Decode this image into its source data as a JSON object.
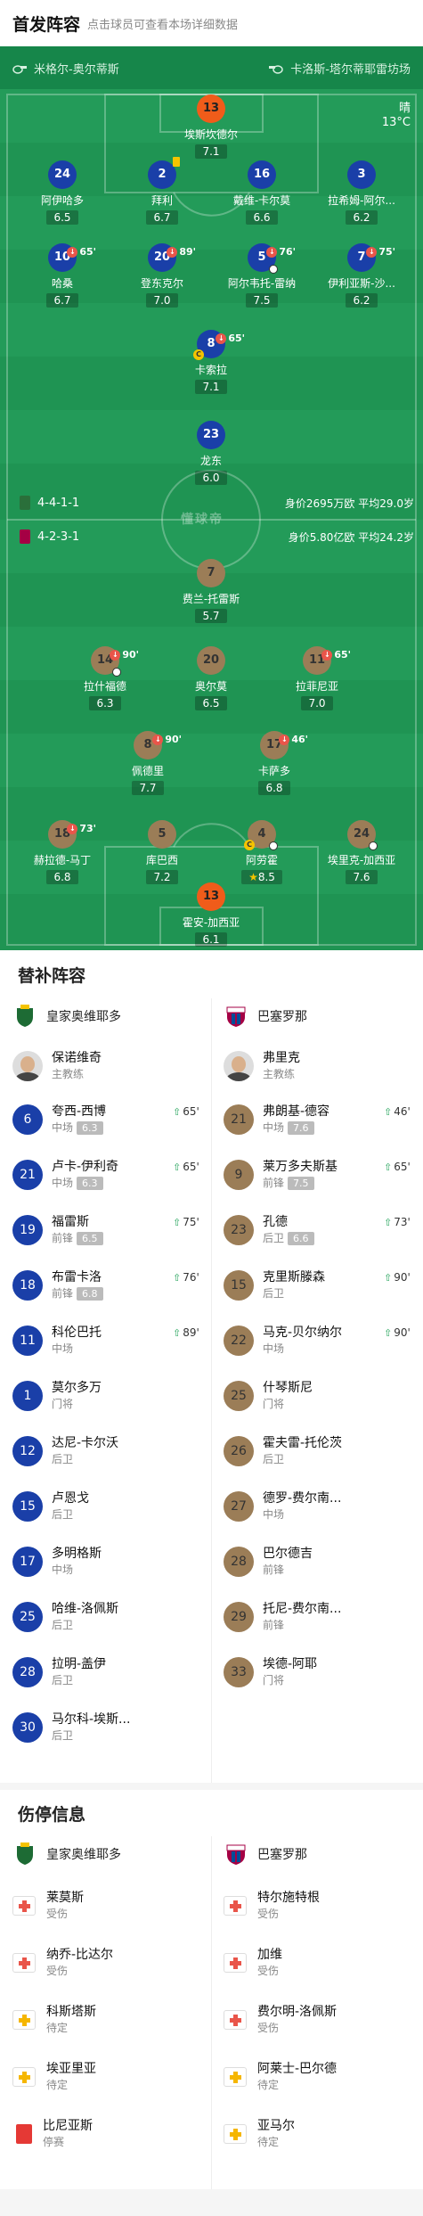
{
  "header": {
    "title": "首发阵容",
    "subtitle": "点击球员可查看本场详细数据"
  },
  "teams": {
    "home": "米格尔-奥尔蒂斯",
    "away": "卡洛斯-塔尔蒂耶雷坊场"
  },
  "weather": {
    "condition": "晴",
    "temp": "13°C"
  },
  "watermark": "懂球帝",
  "home_formation": {
    "formation": "4-4-1-1",
    "value": "身价2695万欧",
    "age": "平均29.0岁"
  },
  "away_formation": {
    "formation": "4-2-3-1",
    "value": "身价5.80亿欧",
    "age": "平均24.2岁"
  },
  "home_players": [
    {
      "no": "13",
      "name": "埃斯坎德尔",
      "rating": "7.1"
    },
    {
      "no": "24",
      "name": "阿伊哈多",
      "rating": "6.5"
    },
    {
      "no": "2",
      "name": "拜利",
      "rating": "6.7"
    },
    {
      "no": "16",
      "name": "戴维-卡尔莫",
      "rating": "6.6"
    },
    {
      "no": "3",
      "name": "拉希姆-阿尔...",
      "rating": "6.2"
    },
    {
      "no": "10",
      "name": "哈桑",
      "rating": "6.7",
      "sub": "65'"
    },
    {
      "no": "20",
      "name": "登东克尔",
      "rating": "7.0",
      "sub": "89'"
    },
    {
      "no": "5",
      "name": "阿尔韦托-雷纳",
      "rating": "7.5",
      "sub": "76'"
    },
    {
      "no": "7",
      "name": "伊利亚斯-沙...",
      "rating": "6.2",
      "sub": "75'"
    },
    {
      "no": "8",
      "name": "卡索拉",
      "rating": "7.1",
      "sub": "65'"
    },
    {
      "no": "23",
      "name": "龙东",
      "rating": "6.0"
    }
  ],
  "away_players": [
    {
      "no": "7",
      "name": "费兰-托雷斯",
      "rating": "5.7"
    },
    {
      "no": "14",
      "name": "拉什福德",
      "rating": "6.3",
      "sub": "90'"
    },
    {
      "no": "20",
      "name": "奥尔莫",
      "rating": "6.5"
    },
    {
      "no": "11",
      "name": "拉菲尼亚",
      "rating": "7.0",
      "sub": "65'"
    },
    {
      "no": "8",
      "name": "佩德里",
      "rating": "7.7",
      "sub": "90'"
    },
    {
      "no": "17",
      "name": "卡萨多",
      "rating": "6.8",
      "sub": "46'"
    },
    {
      "no": "18",
      "name": "赫拉德-马丁",
      "rating": "6.8",
      "sub": "73'"
    },
    {
      "no": "5",
      "name": "库巴西",
      "rating": "7.2"
    },
    {
      "no": "4",
      "name": "阿劳霍",
      "rating": "8.5"
    },
    {
      "no": "24",
      "name": "埃里克-加西亚",
      "rating": "7.6"
    },
    {
      "no": "13",
      "name": "霍安-加西亚",
      "rating": "6.1"
    }
  ],
  "subs": {
    "title": "替补阵容",
    "home_team": "皇家奥维耶多",
    "away_team": "巴塞罗那",
    "home_coach": {
      "name": "保诺维奇",
      "role": "主教练"
    },
    "away_coach": {
      "name": "弗里克",
      "role": "主教练"
    },
    "home": [
      {
        "no": "6",
        "name": "夸西-西博",
        "pos": "中场",
        "rating": "6.3",
        "min": "65'"
      },
      {
        "no": "21",
        "name": "卢卡-伊利奇",
        "pos": "中场",
        "rating": "6.3",
        "min": "65'"
      },
      {
        "no": "19",
        "name": "福雷斯",
        "pos": "前锋",
        "rating": "6.5",
        "min": "75'"
      },
      {
        "no": "18",
        "name": "布雷卡洛",
        "pos": "前锋",
        "rating": "6.8",
        "min": "76'"
      },
      {
        "no": "11",
        "name": "科伦巴托",
        "pos": "中场",
        "rating": "",
        "min": "89'"
      },
      {
        "no": "1",
        "name": "莫尔多万",
        "pos": "门将",
        "rating": "",
        "min": ""
      },
      {
        "no": "12",
        "name": "达尼-卡尔沃",
        "pos": "后卫",
        "rating": "",
        "min": ""
      },
      {
        "no": "15",
        "name": "卢恩戈",
        "pos": "后卫",
        "rating": "",
        "min": ""
      },
      {
        "no": "17",
        "name": "多明格斯",
        "pos": "中场",
        "rating": "",
        "min": ""
      },
      {
        "no": "25",
        "name": "哈维-洛佩斯",
        "pos": "后卫",
        "rating": "",
        "min": ""
      },
      {
        "no": "28",
        "name": "拉明-盖伊",
        "pos": "后卫",
        "rating": "",
        "min": ""
      },
      {
        "no": "30",
        "name": "马尔科-埃斯...",
        "pos": "后卫",
        "rating": "",
        "min": ""
      }
    ],
    "away": [
      {
        "no": "21",
        "name": "弗朗基-德容",
        "pos": "中场",
        "rating": "7.6",
        "min": "46'"
      },
      {
        "no": "9",
        "name": "莱万多夫斯基",
        "pos": "前锋",
        "rating": "7.5",
        "min": "65'"
      },
      {
        "no": "23",
        "name": "孔德",
        "pos": "后卫",
        "rating": "6.6",
        "min": "73'"
      },
      {
        "no": "15",
        "name": "克里斯滕森",
        "pos": "后卫",
        "rating": "",
        "min": "90'"
      },
      {
        "no": "22",
        "name": "马克-贝尔纳尔",
        "pos": "中场",
        "rating": "",
        "min": "90'"
      },
      {
        "no": "25",
        "name": "什琴斯尼",
        "pos": "门将",
        "rating": "",
        "min": ""
      },
      {
        "no": "26",
        "name": "霍夫雷-托伦茨",
        "pos": "后卫",
        "rating": "",
        "min": ""
      },
      {
        "no": "27",
        "name": "德罗-费尔南...",
        "pos": "中场",
        "rating": "",
        "min": ""
      },
      {
        "no": "28",
        "name": "巴尔德吉",
        "pos": "前锋",
        "rating": "",
        "min": ""
      },
      {
        "no": "29",
        "name": "托尼-费尔南...",
        "pos": "前锋",
        "rating": "",
        "min": ""
      },
      {
        "no": "33",
        "name": "埃德-阿耶",
        "pos": "门将",
        "rating": "",
        "min": ""
      }
    ]
  },
  "injuries": {
    "title": "伤停信息",
    "home_team": "皇家奥维耶多",
    "away_team": "巴塞罗那",
    "home": [
      {
        "name": "莱莫斯",
        "status": "受伤",
        "type": "red"
      },
      {
        "name": "纳乔-比达尔",
        "status": "受伤",
        "type": "red"
      },
      {
        "name": "科斯塔斯",
        "status": "待定",
        "type": "yellow"
      },
      {
        "name": "埃亚里亚",
        "status": "待定",
        "type": "yellow"
      },
      {
        "name": "比尼亚斯",
        "status": "停赛",
        "type": "card"
      }
    ],
    "away": [
      {
        "name": "特尔施特根",
        "status": "受伤",
        "type": "red"
      },
      {
        "name": "加维",
        "status": "受伤",
        "type": "red"
      },
      {
        "name": "费尔明-洛佩斯",
        "status": "受伤",
        "type": "red"
      },
      {
        "name": "阿莱士-巴尔德",
        "status": "待定",
        "type": "yellow"
      },
      {
        "name": "亚马尔",
        "status": "待定",
        "type": "yellow"
      }
    ]
  }
}
